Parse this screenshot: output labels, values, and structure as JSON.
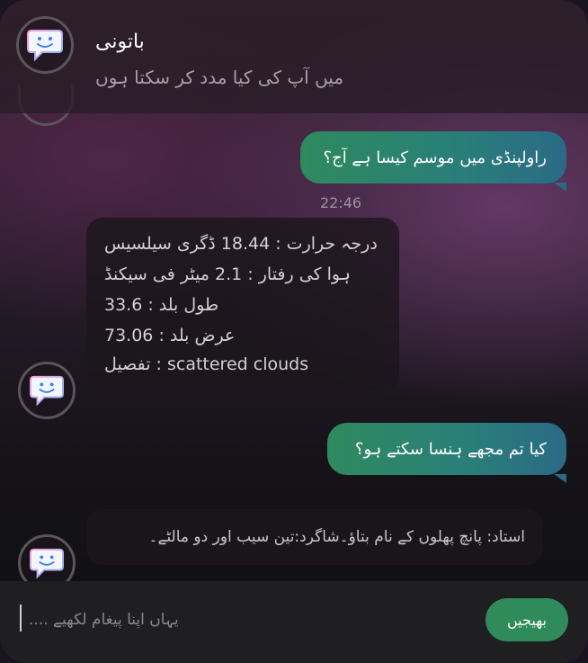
{
  "header": {
    "title": "باتونی",
    "subtitle": "میں آپ کی کیا مدد کر سکتا ہوں",
    "avatar_icon": "chat-bot-icon"
  },
  "messages": [
    {
      "role": "user",
      "text": "راولپنڈی میں موسم کیسا ہے آج؟",
      "time": "22:46"
    },
    {
      "role": "bot",
      "lines": [
        "درجہ حرارت : 18.44 ڈگری سیلسیس",
        "ہوا کی رفتار : 2.1 میٹر فی سیکنڈ",
        "طول بلد : 33.6",
        "عرض بلد : 73.06",
        "تفصیل : scattered clouds"
      ]
    },
    {
      "role": "user",
      "text": "کیا تم مجھے ہنسا سکتے ہو؟"
    },
    {
      "role": "bot",
      "lines": [
        "استاد: پانچ پھلوں کے نام بتاؤ۔شاگرد:تین سیب اور دو مالٹے۔"
      ]
    }
  ],
  "composer": {
    "placeholder": "یہاں اپنا پیغام لکھیے ....",
    "send_label": "بھیجیں"
  },
  "colors": {
    "send_button": "#2f8c5a",
    "user_bubble_start": "#2e8a5e",
    "user_bubble_end": "#2b6a86"
  }
}
